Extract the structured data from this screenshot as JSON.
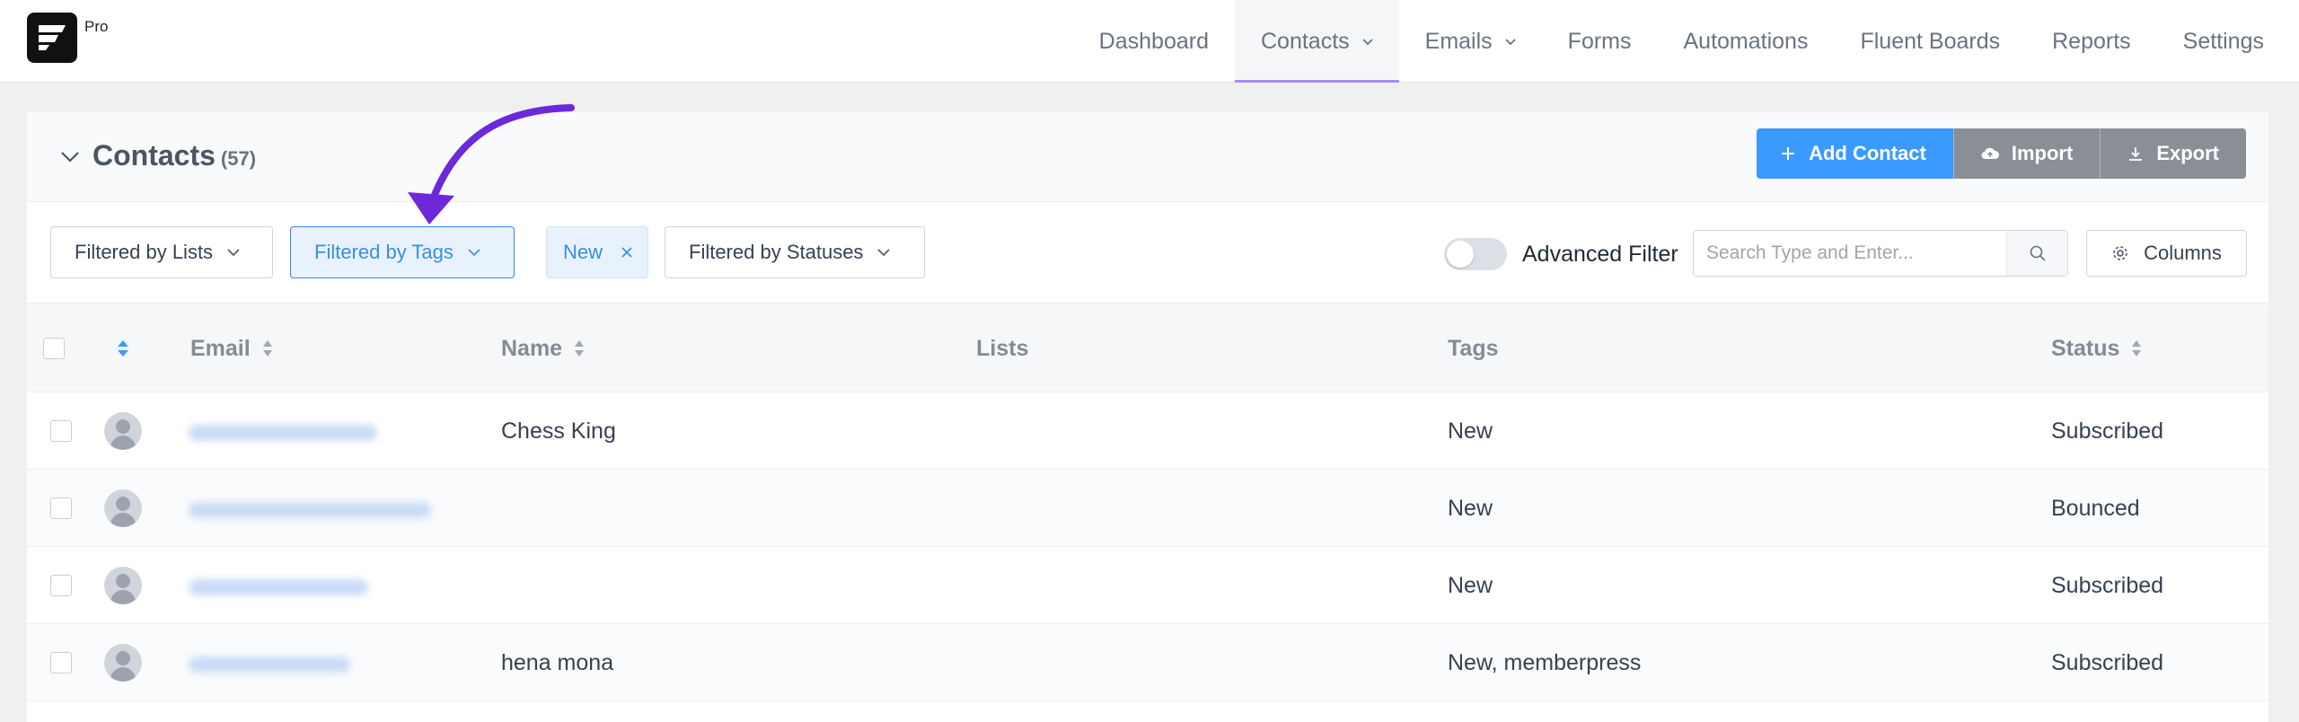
{
  "app": {
    "brand_badge": "Pro"
  },
  "nav": {
    "items": [
      {
        "label": "Dashboard",
        "has_dropdown": false,
        "active": false
      },
      {
        "label": "Contacts",
        "has_dropdown": true,
        "active": true
      },
      {
        "label": "Emails",
        "has_dropdown": true,
        "active": false
      },
      {
        "label": "Forms",
        "has_dropdown": false,
        "active": false
      },
      {
        "label": "Automations",
        "has_dropdown": false,
        "active": false
      },
      {
        "label": "Fluent Boards",
        "has_dropdown": false,
        "active": false
      },
      {
        "label": "Reports",
        "has_dropdown": false,
        "active": false
      },
      {
        "label": "Settings",
        "has_dropdown": false,
        "active": false
      }
    ]
  },
  "page": {
    "title": "Contacts",
    "count": "(57)",
    "actions": {
      "add": "Add Contact",
      "import": "Import",
      "export": "Export"
    }
  },
  "filters": {
    "lists": "Filtered by Lists",
    "tags": "Filtered by Tags",
    "selected_tag": "New",
    "statuses": "Filtered by Statuses",
    "advanced_label": "Advanced Filter",
    "advanced_enabled": false,
    "search_placeholder": "Search Type and Enter...",
    "columns": "Columns"
  },
  "table": {
    "headers": {
      "email": "Email",
      "name": "Name",
      "lists": "Lists",
      "tags": "Tags",
      "status": "Status"
    },
    "rows": [
      {
        "name": "Chess King",
        "lists": "",
        "tags": "New",
        "status": "Subscribed"
      },
      {
        "name": "",
        "lists": "",
        "tags": "New",
        "status": "Bounced"
      },
      {
        "name": "",
        "lists": "",
        "tags": "New",
        "status": "Subscribed"
      },
      {
        "name": "hena mona",
        "lists": "",
        "tags": "New, memberpress",
        "status": "Subscribed"
      }
    ]
  },
  "colors": {
    "primary": "#3b9aff",
    "secondary_button": "#8a8f96",
    "nav_active_underline": "#a78bfa",
    "annotation_arrow": "#6d28d9",
    "active_filter_bg": "#e8f2fd"
  }
}
